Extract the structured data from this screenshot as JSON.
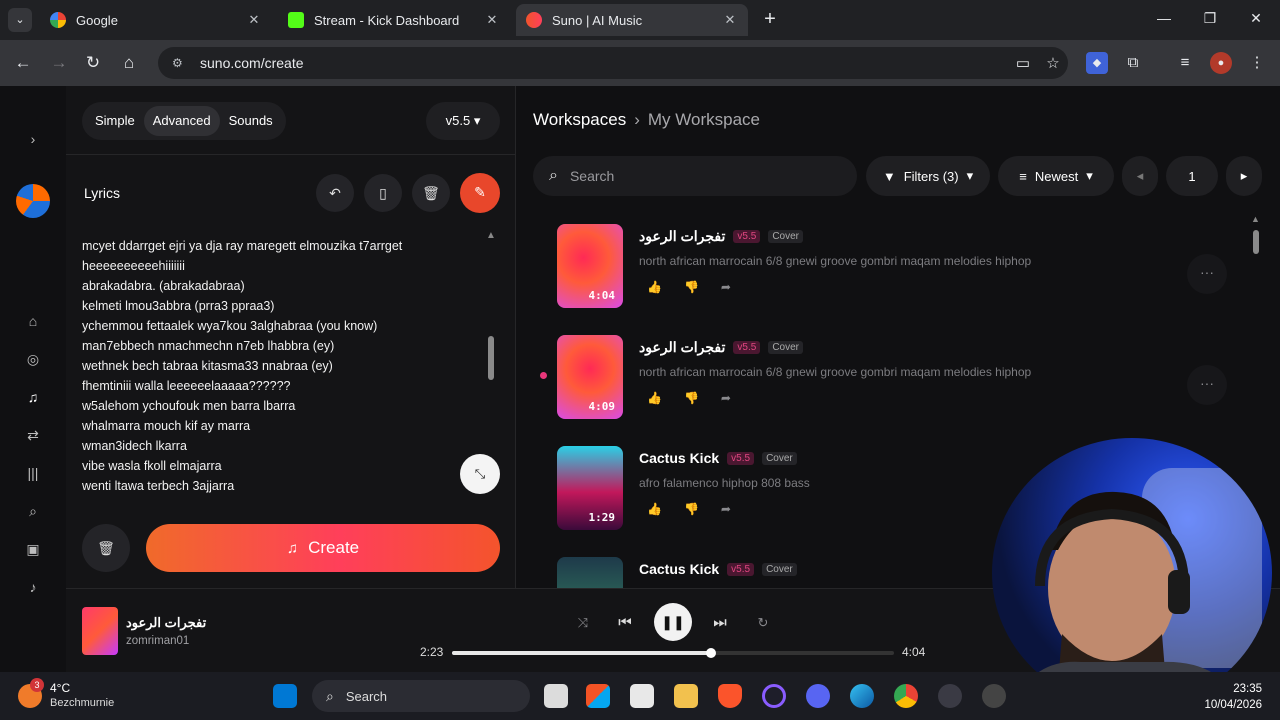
{
  "browser": {
    "tabs": [
      {
        "title": "Google",
        "color": "#4285f4"
      },
      {
        "title": "Stream - Kick Dashboard",
        "color": "#53fc18"
      },
      {
        "title": "Suno | AI Music",
        "color": "#f0542c"
      }
    ],
    "url": "suno.com/create"
  },
  "composer": {
    "modes": [
      "Simple",
      "Advanced",
      "Sounds"
    ],
    "active_mode": "Advanced",
    "version": "v5.5",
    "lyrics_label": "Lyrics",
    "lyrics_lines": [
      "mcyet ddarrget  ejri ya dja ray maregett elmouzika t7arrget",
      "heeeeeeeeeehiiiiiii",
      "abrakadabra. (abrakadabraa)",
      "kelmeti lmou3abbra (prra3 ppraa3)",
      "ychemmou fettaalek wya7kou 3alghabraa (you know)",
      "man7ebbech nmachmechn n7eb lhabbra (ey)",
      "wethnek bech tabraa kitasma33 nnabraa (ey)",
      "fhemtiniii walla leeeeeelaaaaa??????",
      "w5alehom ychoufouk men barra lbarra",
      "whalmarra mouch kif ay marra",
      " wman3idech lkarra",
      "vibe wasla fkoll elmajarra",
      "wenti ltawa terbech 3ajjarra"
    ],
    "create_label": "Create"
  },
  "workspace": {
    "crumb_root": "Workspaces",
    "crumb_current": "My Workspace",
    "search_placeholder": "Search",
    "filters_label": "Filters (3)",
    "sort_label": "Newest",
    "page": "1"
  },
  "songs": [
    {
      "title": "تفجرات الرعود",
      "version": "v5.5",
      "tag": "Cover",
      "desc": "north african marrocain 6/8 gnewi groove gombri maqam melodies hiphop",
      "duration": "4:04"
    },
    {
      "title": "تفجرات الرعود",
      "version": "v5.5",
      "tag": "Cover",
      "desc": "north african marrocain 6/8 gnewi groove gombri maqam melodies hiphop",
      "duration": "4:09"
    },
    {
      "title": "Cactus Kick",
      "version": "v5.5",
      "tag": "Cover",
      "desc": "afro falamenco hiphop 808 bass",
      "duration": "1:29"
    },
    {
      "title": "Cactus Kick",
      "version": "v5.5",
      "tag": "Cover",
      "desc": "",
      "duration": ""
    }
  ],
  "player": {
    "title": "تفجرات الرعود",
    "artist": "zomriman01",
    "elapsed": "2:23",
    "total": "4:04",
    "progress": 0.586
  },
  "taskbar": {
    "weather_temp": "4°C",
    "weather_location": "Bezchmurnie",
    "weather_badge": "3",
    "search_label": "Search",
    "time": "23:35",
    "date": "10/04/2026"
  },
  "colors": {
    "accent": "#e8472b",
    "version_badge": "#e04680"
  }
}
